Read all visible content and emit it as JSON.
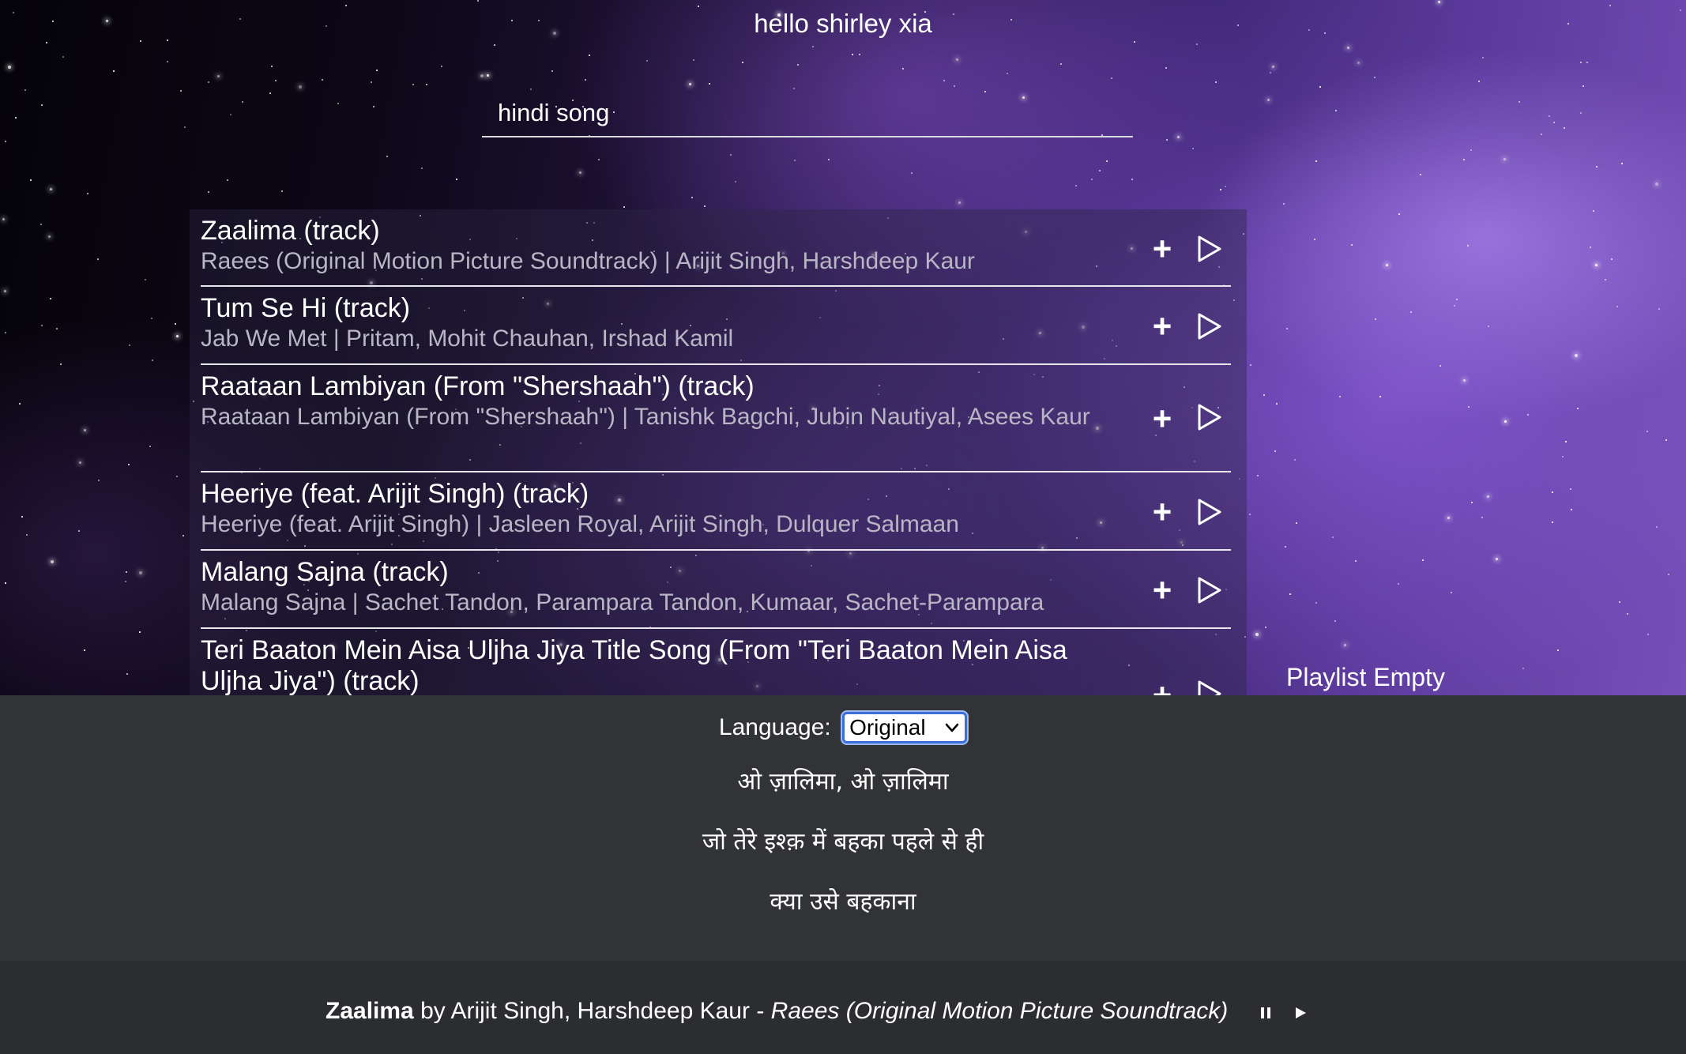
{
  "greeting": "hello shirley xia",
  "search": {
    "value": "hindi song"
  },
  "results": [
    {
      "title": "Zaalima (track)",
      "subtitle": "Raees (Original Motion Picture Soundtrack) | Arijit Singh, Harshdeep Kaur",
      "add_label": "+",
      "play_icon": "play-outline-icon"
    },
    {
      "title": "Tum Se Hi (track)",
      "subtitle": "Jab We Met | Pritam, Mohit Chauhan, Irshad Kamil",
      "add_label": "+",
      "play_icon": "play-outline-icon"
    },
    {
      "title": "Raataan Lambiyan (From \"Shershaah\") (track)",
      "subtitle": "Raataan Lambiyan (From \"Shershaah\") | Tanishk Bagchi, Jubin Nautiyal, Asees Kaur",
      "add_label": "+",
      "play_icon": "play-outline-icon"
    },
    {
      "title": "Heeriye (feat. Arijit Singh) (track)",
      "subtitle": "Heeriye (feat. Arijit Singh) | Jasleen Royal, Arijit Singh, Dulquer Salmaan",
      "add_label": "+",
      "play_icon": "play-outline-icon"
    },
    {
      "title": "Malang Sajna (track)",
      "subtitle": "Malang Sajna | Sachet Tandon, Parampara Tandon, Kumaar, Sachet-Parampara",
      "add_label": "+",
      "play_icon": "play-outline-icon"
    },
    {
      "title": "Teri Baaton Mein Aisa Uljha Jiya Title Song (From \"Teri Baaton Mein Aisa Uljha Jiya\") (track)",
      "subtitle": "",
      "add_label": "+",
      "play_icon": "play-outline-icon"
    }
  ],
  "playlist": {
    "empty_text": "Playlist Empty"
  },
  "lyrics": {
    "language_label": "Language:",
    "language_selected": "Original",
    "lines": [
      "ओ ज़ालिमा, ओ ज़ालिमा",
      "जो तेरे इश्क़ में बहका पहले से ही",
      "क्या उसे बहकाना"
    ]
  },
  "now_playing": {
    "title": "Zaalima",
    "by_word": "by",
    "artists": "Arijit Singh, Harshdeep Kaur",
    "separator": "-",
    "album": "Raees (Original Motion Picture Soundtrack)",
    "pause_icon": "pause-icon",
    "play_icon": "play-icon"
  },
  "colors": {
    "lyrics_bg": "#323337",
    "player_bg": "#2c2d31",
    "subtitle_text": "#b8b6c4",
    "select_focus": "#3b6fd8"
  }
}
